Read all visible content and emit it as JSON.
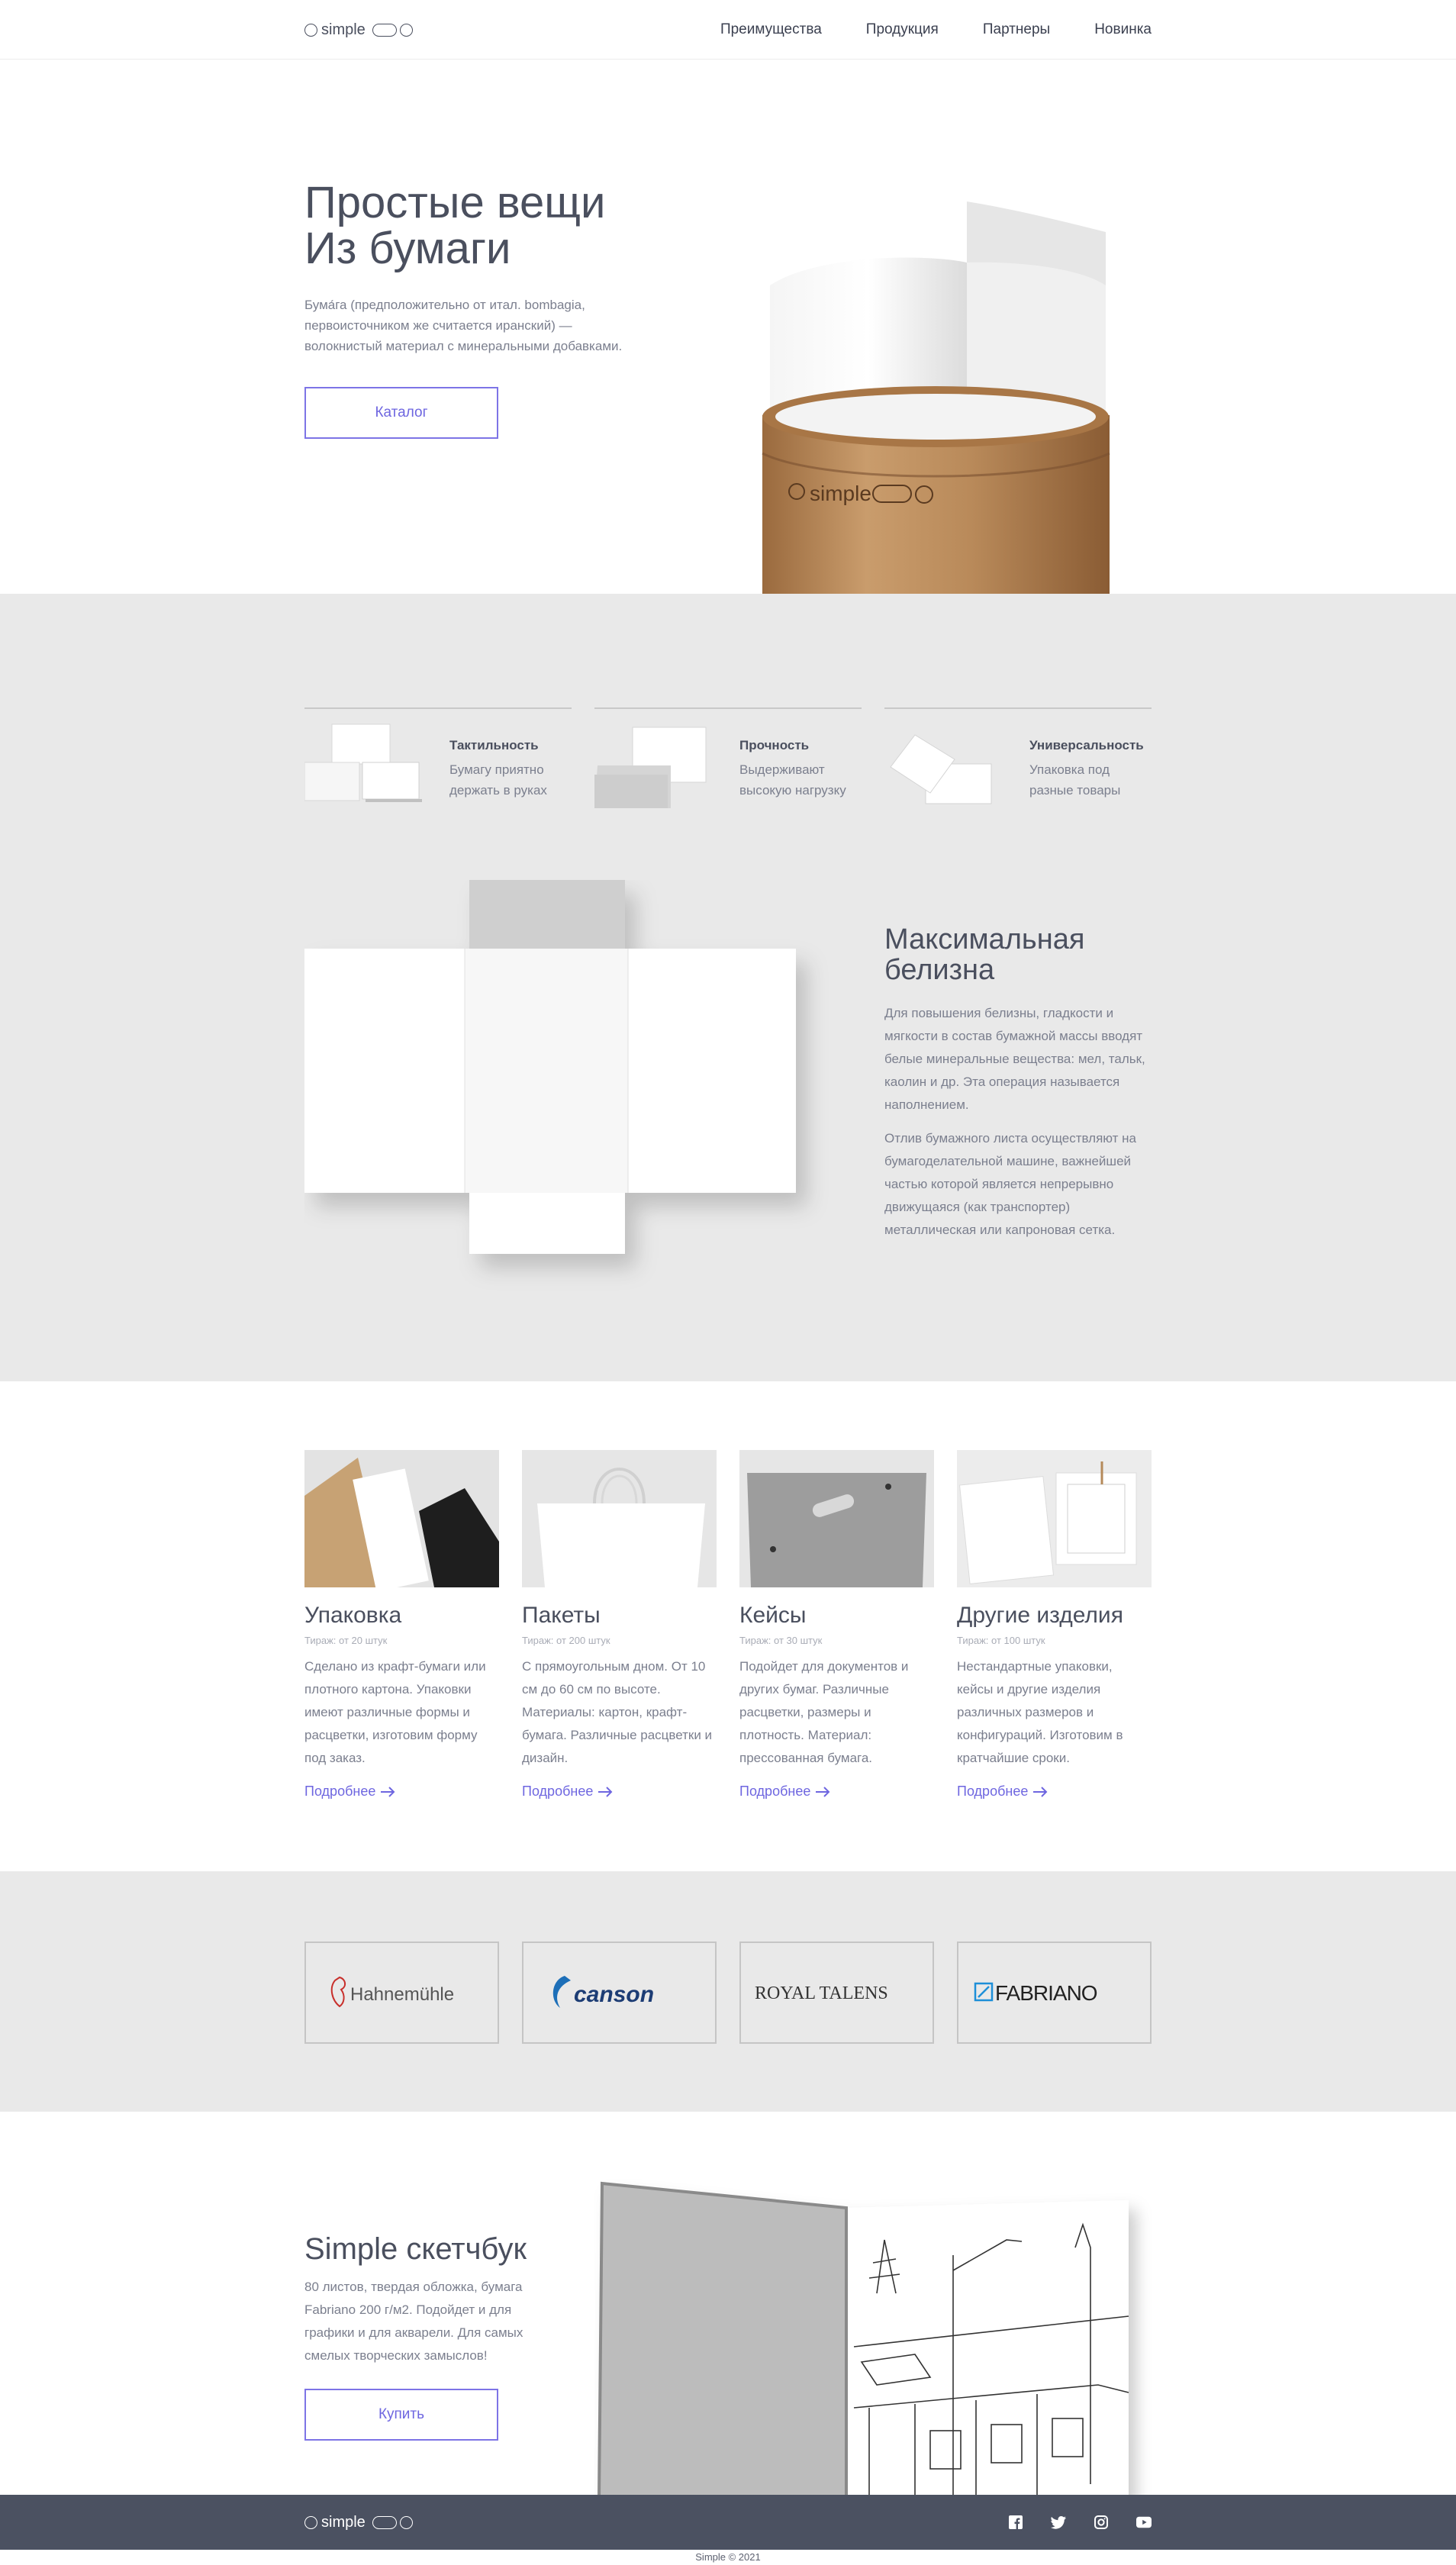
{
  "brand": {
    "name": "simple"
  },
  "nav": {
    "items": [
      "Преимущества",
      "Продукция",
      "Партнеры",
      "Новинка"
    ]
  },
  "hero": {
    "title_line1": "Простые вещи",
    "title_line2": "Из бумаги",
    "description": "Бума́га (предположительно от итал. bombagia, первоисточником же считается иранский) — волокнистый материал с минеральными добавками.",
    "button": "Каталог",
    "tube_label": "simple"
  },
  "features": {
    "items": [
      {
        "title": "Тактильность",
        "description": "Бумагу приятно держать в руках"
      },
      {
        "title": "Прочность",
        "description": "Выдерживают высокую нагрузку"
      },
      {
        "title": "Универсальность",
        "description": "Упаковка под разные товары"
      }
    ]
  },
  "whiteness": {
    "title": "Максимальная белизна",
    "paragraph1": "Для повышения белизны, гладкости и мягкости в состав бумажной массы вводят белые минеральные вещества: мел, тальк, каолин и др. Эта операция называется наполнением.",
    "paragraph2": "Отлив бумажного листа осуществляют на бумагоделательной машине, важнейшей частью которой является непрерывно движущаяся (как транспортер) металлическая или капроновая сетка."
  },
  "products": {
    "items": [
      {
        "title": "Упаковка",
        "subtitle": "Тираж: от 20 штук",
        "description": "Сделано из крафт-бумаги или плотного картона. Упаковки имеют различные формы и расцветки, изготовим форму под заказ.",
        "link": "Подробнее"
      },
      {
        "title": "Пакеты",
        "subtitle": "Тираж: от 200 штук",
        "description": "С прямоугольным дном. От 10 см до 60 см по высоте. Материалы: картон, крафт-бумага. Различные расцветки и дизайн.",
        "link": "Подробнее"
      },
      {
        "title": "Кейсы",
        "subtitle": "Тираж: от 30 штук",
        "description": "Подойдет для документов и других бумаг. Различные расцветки, размеры и плотность. Материал: прессованная бумага.",
        "link": "Подробнее"
      },
      {
        "title": "Другие изделия",
        "subtitle": "Тираж: от 100 штук",
        "description": "Нестандартные упаковки, кейсы и другие изделия различных размеров и конфигураций. Изготовим в кратчайшие сроки.",
        "link": "Подробнее"
      }
    ]
  },
  "partners": {
    "items": [
      "Hahnemühle",
      "canson",
      "ROYAL TALENS",
      "FABRIANO"
    ]
  },
  "sketchbook": {
    "title": "Simple скетчбук",
    "description": "80 листов, твердая обложка, бумага Fabriano 200 г/м2. Подойдет и для графики и для акварели. Для самых смелых творческих замыслов!",
    "button": "Купить"
  },
  "footer": {
    "socials": [
      "facebook-icon",
      "twitter-icon",
      "instagram-icon",
      "youtube-icon"
    ],
    "copyright": "Simple © 2021"
  },
  "colors": {
    "accent": "#6e66e0",
    "text": "#4a4f5e",
    "muted": "#7b7f8e",
    "gray_bg": "#e9e9e9",
    "footer_bg": "#4b5161"
  }
}
